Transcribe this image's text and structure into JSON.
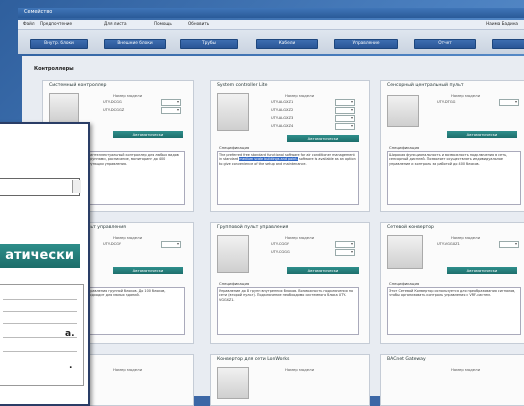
{
  "window": {
    "title": "Семейство"
  },
  "menu": [
    {
      "label": "Файл"
    },
    {
      "label": "Предпочтение"
    },
    {
      "label": "Для листа"
    },
    {
      "label": "Помощь"
    },
    {
      "label": "Обновить"
    }
  ],
  "user": "Наима Бадина",
  "nav": [
    {
      "label": "Внутр. блоки"
    },
    {
      "label": "Внешние блоки"
    },
    {
      "label": "Трубы"
    },
    {
      "label": "Кабели"
    },
    {
      "label": "Управление"
    },
    {
      "label": "Отчет"
    }
  ],
  "section_title": "Контроллеры",
  "cards": [
    {
      "title": "Системный контроллер",
      "model_label": "Номер модели",
      "codes": [
        "UTY-DCGG",
        "UTY-DCGGZ"
      ],
      "button": "Автоматически",
      "spec_label": "Спецификация",
      "spec": "Централизованный и интеллектуальный контроллер для любых видов зданий. Управление группами, расписание, мониторинг до 400 внутренних блоков. Функции управления."
    },
    {
      "title": "System controller Lite",
      "model_label": "Номер модели",
      "codes": [
        "UTY-ALGXZ1",
        "UTY-ALGXZ2",
        "UTY-ALGXZ3",
        "UTY-ALGXZ4"
      ],
      "button": "Автоматически",
      "spec_label": "Спецификация",
      "spec_pre": "The preferred free standard functional software for air conditioner management in standard ",
      "spec_hl": "medium scale buildings and point-",
      "spec_post": " software is available as an option to give convenience of the setup and maintenance."
    },
    {
      "title": "Сенсорный центральный пульт",
      "model_label": "Номер модели",
      "codes": [
        "UTY-DTGG"
      ],
      "button": "Автоматически",
      "spec_label": "Спецификация",
      "spec": "Широкая функциональность и возможность подключения в сеть, сенсорный дисплей. Позволяет осуществлять индивидуальное управление и контроль за работой до 400 блоков."
    },
    {
      "title": "Упрощённый пульт управления",
      "model_label": "Номер модели",
      "codes": [
        "UTY-DCGY"
      ],
      "button": "Автоматически",
      "spec_label": "Спецификация",
      "spec": "Простой пульт для управления группой блоков. До 100 блоков, недельный таймер, подходит для малых зданий."
    },
    {
      "title": "Групповой пульт управления",
      "model_label": "Номер модели",
      "codes": [
        "UTY-CGGY",
        "UTY-CGGG"
      ],
      "button": "Автоматически",
      "spec_label": "Спецификация",
      "spec": "Управление до 8 групп внутренних блоков. Возможность подключения по сети (второй пульт). Подключение необходимо системного блока UTY-VGGXZ1."
    },
    {
      "title": "Сетевой конвертор",
      "model_label": "Номер модели",
      "codes": [
        "UTY-VGGXZ1"
      ],
      "button": "Автоматически",
      "spec_label": "Спецификация",
      "spec": "Этот Сетевой Конвертор используется для преобразования сигналов, чтобы организовать контроль управления с VRF-систем."
    },
    {
      "title": "Плата сигналов",
      "model_label": "Номер модели",
      "codes": [],
      "button": "",
      "spec_label": "",
      "spec": ""
    },
    {
      "title": "Конвертор для сети LonWorks",
      "model_label": "Номер модели",
      "codes": [],
      "button": "",
      "spec_label": "",
      "spec": ""
    },
    {
      "title": "BACnet Gateway",
      "model_label": "Номер модели",
      "codes": [],
      "button": "",
      "spec_label": "",
      "spec": ""
    }
  ],
  "zoom": {
    "button_label": "атически",
    "text_lines": [
      "а.",
      "."
    ]
  }
}
